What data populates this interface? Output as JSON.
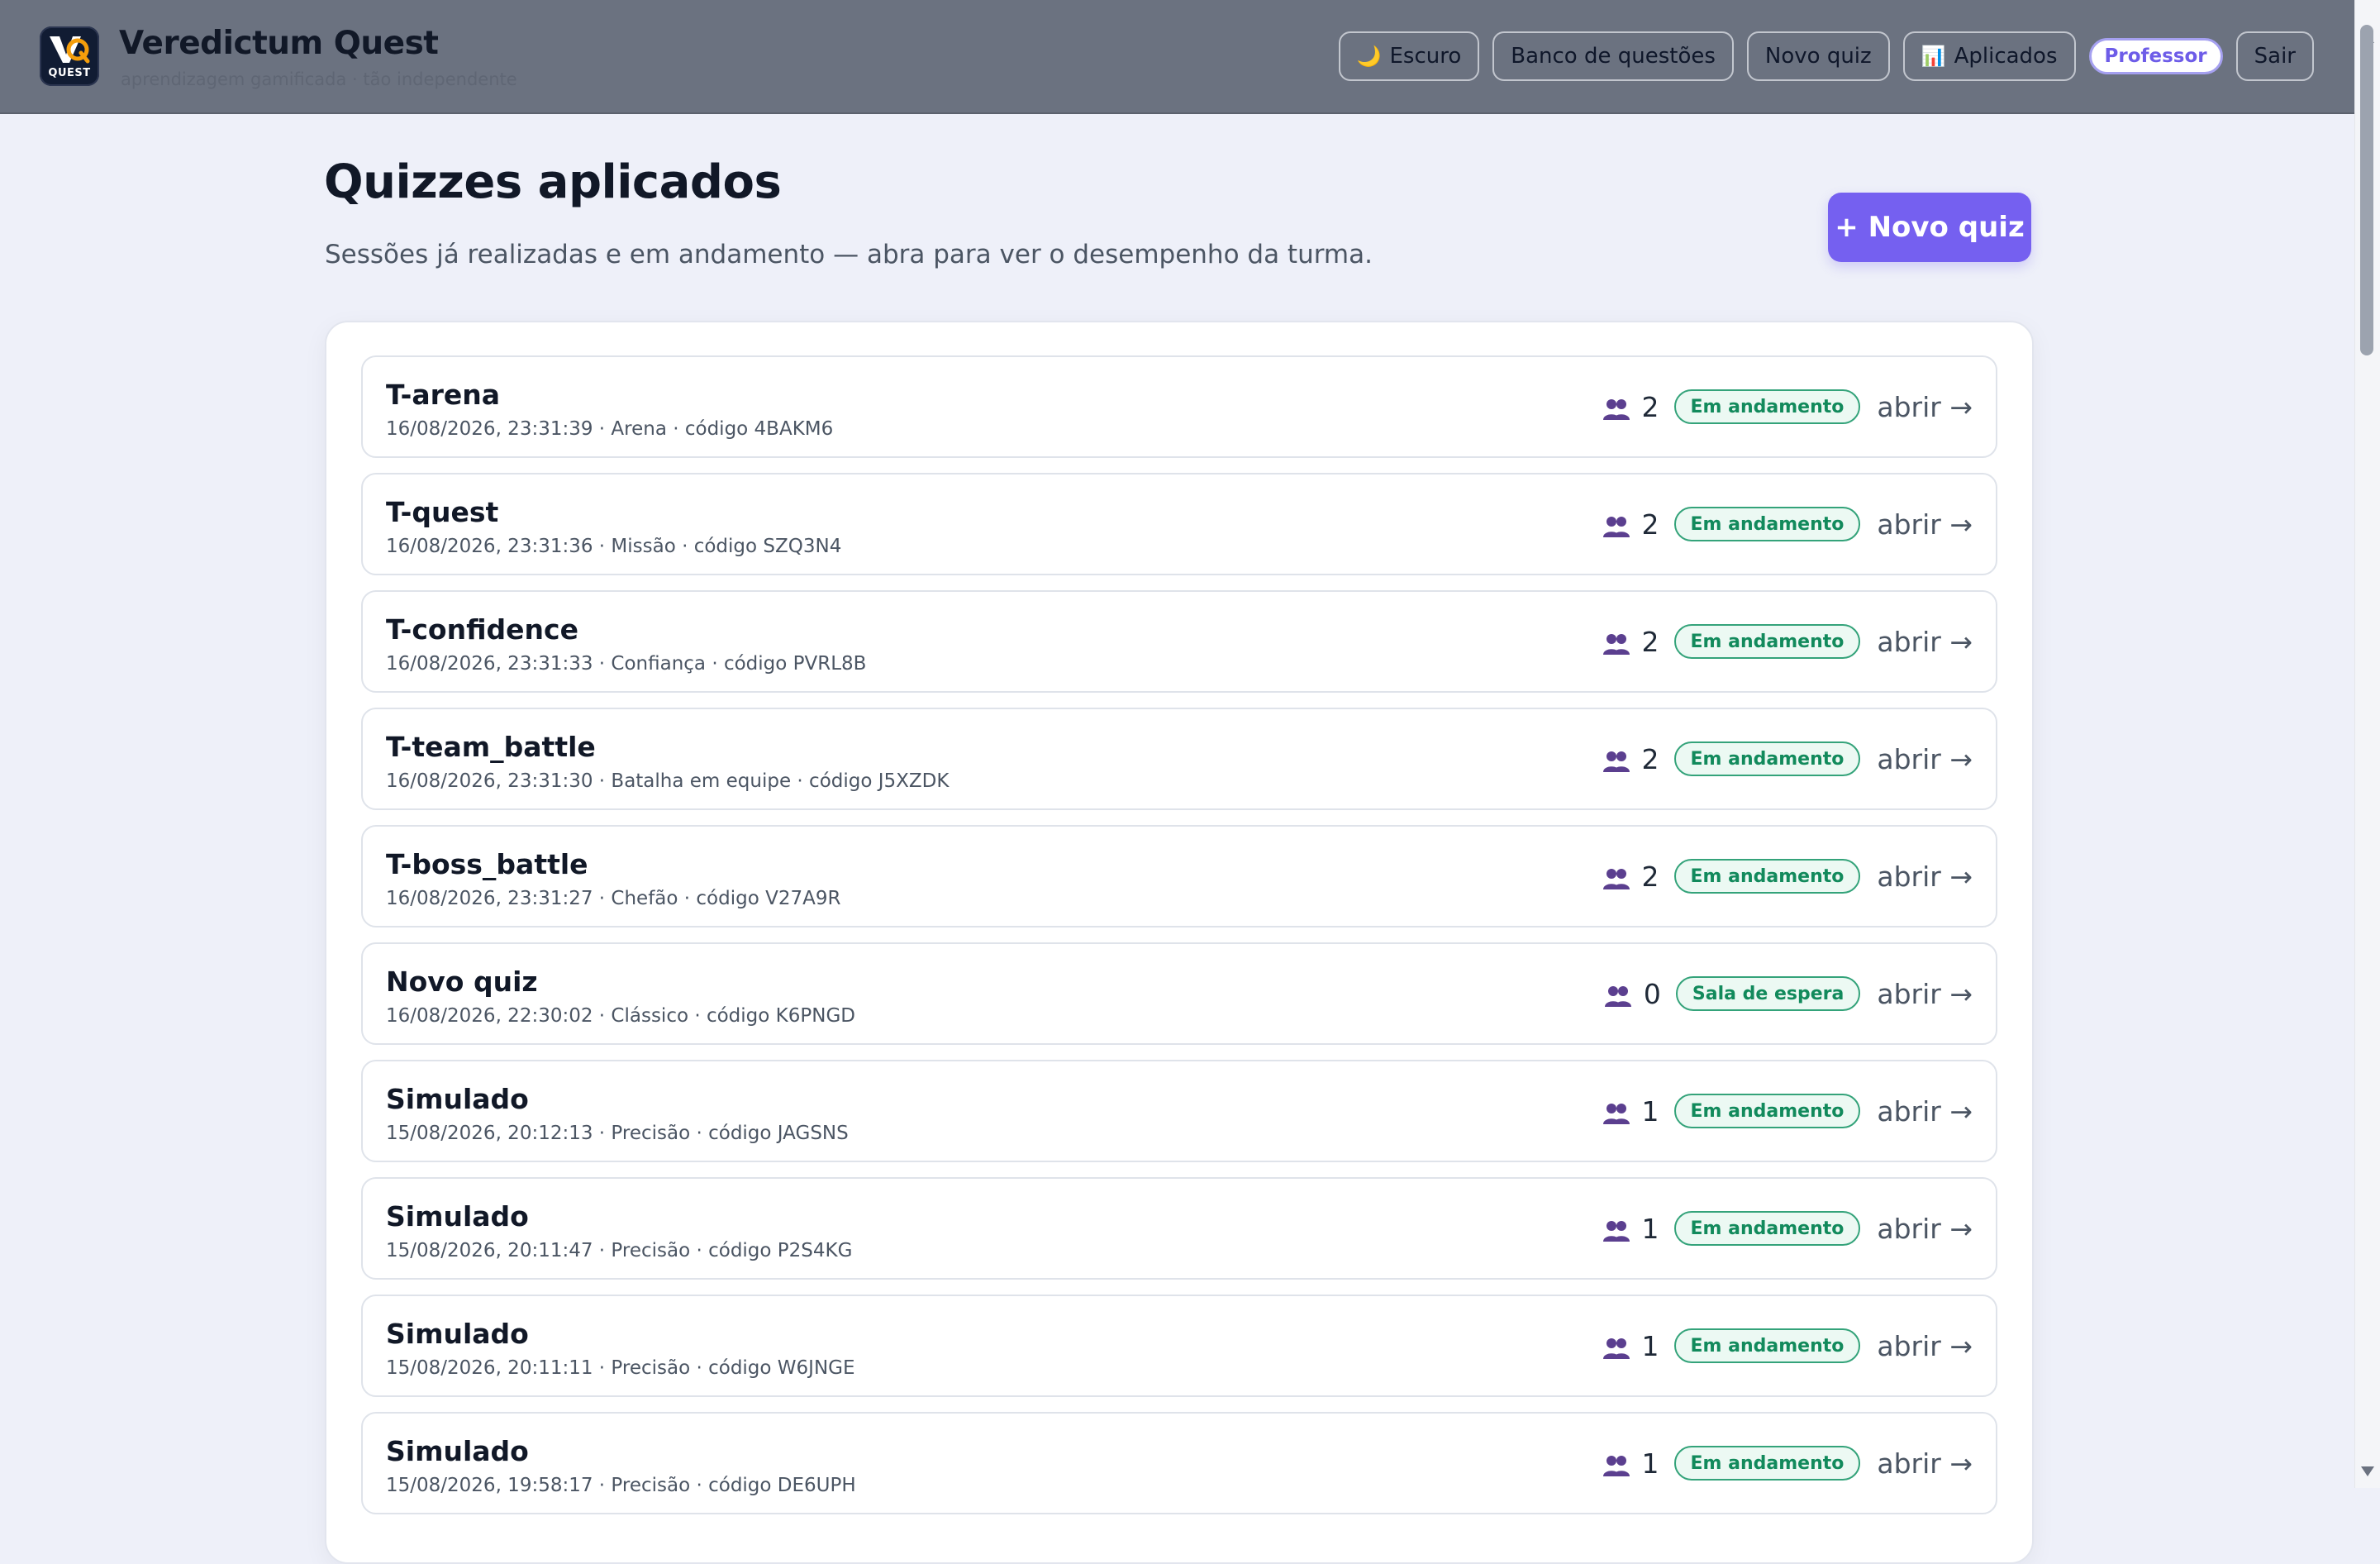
{
  "header": {
    "brand_title": "Veredictum Quest",
    "brand_subtitle": "aprendizagem gamificada · tão independente",
    "logo_text": "VQ",
    "logo_subtext": "QUEST",
    "nav": {
      "theme": {
        "icon": "moon-icon",
        "label": "Escuro"
      },
      "bank": "Banco de questões",
      "new_quiz": "Novo quiz",
      "applied": {
        "icon": "bar-chart-icon",
        "label": "Aplicados"
      },
      "role": "Professor",
      "logout": "Sair"
    }
  },
  "main": {
    "title": "Quizzes aplicados",
    "subtitle": "Sessões já realizadas e em andamento — abra para ver o desempenho da turma.",
    "new_quiz_button": "+ Novo quiz",
    "open_label": "abrir →",
    "sessions": [
      {
        "title": "T-arena",
        "meta": "16/08/2026, 23:31:39 · Arena · código 4BAKM6",
        "participants": "2",
        "status": "Em andamento"
      },
      {
        "title": "T-quest",
        "meta": "16/08/2026, 23:31:36 · Missão · código SZQ3N4",
        "participants": "2",
        "status": "Em andamento"
      },
      {
        "title": "T-confidence",
        "meta": "16/08/2026, 23:31:33 · Confiança · código PVRL8B",
        "participants": "2",
        "status": "Em andamento"
      },
      {
        "title": "T-team_battle",
        "meta": "16/08/2026, 23:31:30 · Batalha em equipe · código J5XZDK",
        "participants": "2",
        "status": "Em andamento"
      },
      {
        "title": "T-boss_battle",
        "meta": "16/08/2026, 23:31:27 · Chefão · código V27A9R",
        "participants": "2",
        "status": "Em andamento"
      },
      {
        "title": "Novo quiz",
        "meta": "16/08/2026, 22:30:02 · Clássico · código K6PNGD",
        "participants": "0",
        "status": "Sala de espera"
      },
      {
        "title": "Simulado",
        "meta": "15/08/2026, 20:12:13 · Precisão · código JAGSNS",
        "participants": "1",
        "status": "Em andamento"
      },
      {
        "title": "Simulado",
        "meta": "15/08/2026, 20:11:47 · Precisão · código P2S4KG",
        "participants": "1",
        "status": "Em andamento"
      },
      {
        "title": "Simulado",
        "meta": "15/08/2026, 20:11:11 · Precisão · código W6JNGE",
        "participants": "1",
        "status": "Em andamento"
      },
      {
        "title": "Simulado",
        "meta": "15/08/2026, 19:58:17 · Precisão · código DE6UPH",
        "participants": "1",
        "status": "Em andamento"
      }
    ]
  },
  "icons": {
    "participants": "people-icon"
  },
  "colors": {
    "accent": "#7560f0",
    "status_green": "#128a5c",
    "topbar": "#6b7280"
  }
}
